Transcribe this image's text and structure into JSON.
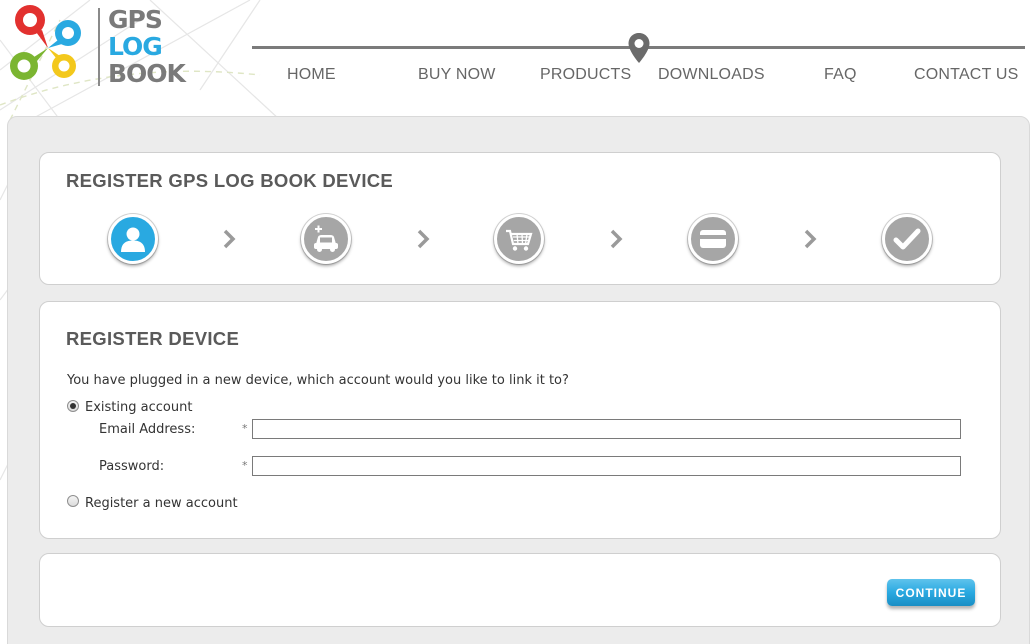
{
  "logo": {
    "word1": "GPS",
    "word2": "LOG",
    "word3": "BOOK",
    "icon": "colorful-pin-flower-icon"
  },
  "nav": {
    "items": [
      {
        "label": "HOME"
      },
      {
        "label": "BUY NOW"
      },
      {
        "label": "PRODUCTS"
      },
      {
        "label": "DOWNLOADS"
      },
      {
        "label": "FAQ"
      },
      {
        "label": "CONTACT US"
      }
    ],
    "pin_icon": "location-pin-icon"
  },
  "steps": {
    "title": "REGISTER GPS LOG BOOK DEVICE",
    "items": [
      {
        "icon": "user-icon",
        "active": true
      },
      {
        "icon": "car-add-icon",
        "active": false
      },
      {
        "icon": "shopping-cart-icon",
        "active": false
      },
      {
        "icon": "credit-card-icon",
        "active": false
      },
      {
        "icon": "checkmark-icon",
        "active": false
      }
    ]
  },
  "form": {
    "title": "REGISTER DEVICE",
    "prompt": "You have plugged in a new device, which account would you like to link it to?",
    "existing_label": "Existing account",
    "email_label": "Email Address:",
    "password_label": "Password:",
    "required_mark": "*",
    "email_value": "",
    "password_value": "",
    "new_account_label": "Register a new account",
    "selected": "existing"
  },
  "actions": {
    "continue_label": "CONTINUE"
  },
  "colors": {
    "accent": "#29a9e1",
    "step_inactive": "#a6a6a6",
    "heading": "#5a5a5a",
    "nav_text": "#666666"
  }
}
